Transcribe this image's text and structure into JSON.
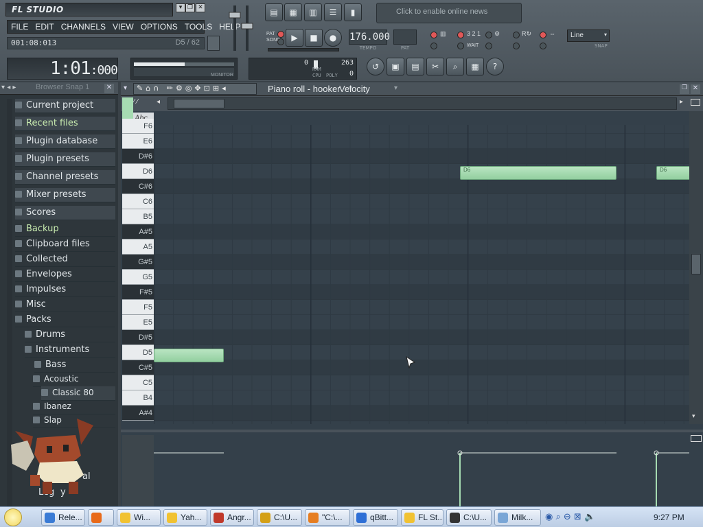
{
  "app": {
    "logo": "FL STUDIO",
    "menu": [
      "FILE",
      "EDIT",
      "CHANNELS",
      "VIEW",
      "OPTIONS",
      "TOOLS",
      "HELP"
    ],
    "song_position": "001:08:013",
    "song_position_note": "D5 / 62",
    "time_display": "1:01",
    "time_display_ms": ":000",
    "news_hint": "Click to enable online news",
    "tempo": "176.000",
    "tempo_label": "TEMPO",
    "pat_label": "PAT",
    "snap_mode": "Line",
    "snap_label": "SNAP",
    "pat_song_labels": [
      "PAT",
      "SONG"
    ],
    "cpu": {
      "ram_value": "0",
      "poly_value": "263",
      "poly_sub": "0",
      "ram_label": "RAM",
      "cpu_label": "CPU",
      "poly_label": "POLY",
      "monitor_label": "MONITOR"
    },
    "wait_label": "WAIT",
    "counter_label": "3 2 1"
  },
  "browser": {
    "header": "Browser   Snap 1",
    "items": [
      {
        "label": "Current project",
        "style": "top"
      },
      {
        "label": "Recent files",
        "style": "top green"
      },
      {
        "label": "Plugin database",
        "style": "top"
      },
      {
        "label": "Plugin presets",
        "style": "top"
      },
      {
        "label": "Channel presets",
        "style": "top"
      },
      {
        "label": "Mixer presets",
        "style": "top"
      },
      {
        "label": "Scores",
        "style": "top"
      },
      {
        "label": "Backup",
        "style": "green"
      },
      {
        "label": "Clipboard files",
        "style": ""
      },
      {
        "label": "Collected",
        "style": ""
      },
      {
        "label": "Envelopes",
        "style": ""
      },
      {
        "label": "Impulses",
        "style": ""
      },
      {
        "label": "Misc",
        "style": ""
      },
      {
        "label": "Packs",
        "style": ""
      },
      {
        "label": "Drums",
        "style": "sub1"
      },
      {
        "label": "Instruments",
        "style": "sub1"
      },
      {
        "label": "Bass",
        "style": "sub2"
      },
      {
        "label": "Acoustic",
        "style": "sub4"
      },
      {
        "label": "Classic 80",
        "style": "sub5"
      },
      {
        "label": "Ibanez",
        "style": "sub4"
      },
      {
        "label": "Slap",
        "style": "sub4"
      }
    ],
    "partial_labels": [
      "al",
      "Leg",
      "y"
    ]
  },
  "piano_roll": {
    "title": "Piano roll - hooker",
    "target": "Velocity",
    "abc": "Abc",
    "keys": [
      {
        "label": "F6",
        "color": "white"
      },
      {
        "label": "E6",
        "color": "white"
      },
      {
        "label": "D#6",
        "color": "black"
      },
      {
        "label": "D6",
        "color": "white"
      },
      {
        "label": "C#6",
        "color": "black"
      },
      {
        "label": "C6",
        "color": "white"
      },
      {
        "label": "B5",
        "color": "white"
      },
      {
        "label": "A#5",
        "color": "black"
      },
      {
        "label": "A5",
        "color": "white"
      },
      {
        "label": "G#5",
        "color": "black"
      },
      {
        "label": "G5",
        "color": "white"
      },
      {
        "label": "F#5",
        "color": "black"
      },
      {
        "label": "F5",
        "color": "white"
      },
      {
        "label": "E5",
        "color": "white"
      },
      {
        "label": "D#5",
        "color": "black"
      },
      {
        "label": "D5",
        "color": "white"
      },
      {
        "label": "C#5",
        "color": "black"
      },
      {
        "label": "C5",
        "color": "white"
      },
      {
        "label": "B4",
        "color": "white"
      },
      {
        "label": "A#4",
        "color": "black"
      }
    ],
    "notes": [
      {
        "label": "D6"
      },
      {
        "label": "D6"
      },
      {
        "label": ""
      }
    ]
  },
  "taskbar": {
    "tasks": [
      "Rele...",
      "",
      "Wi...",
      "Yah...",
      "Angr...",
      "C:\\U...",
      "\"C:\\...",
      "qBitt...",
      "FL St...",
      "C:\\U...",
      "Milk..."
    ],
    "clock": "9:27 PM"
  },
  "colors": {
    "note_fill": "#a6dcb2",
    "grid_bg": "#34404a",
    "led_red": "#e05858",
    "taskbar": "#c8d8ee"
  }
}
